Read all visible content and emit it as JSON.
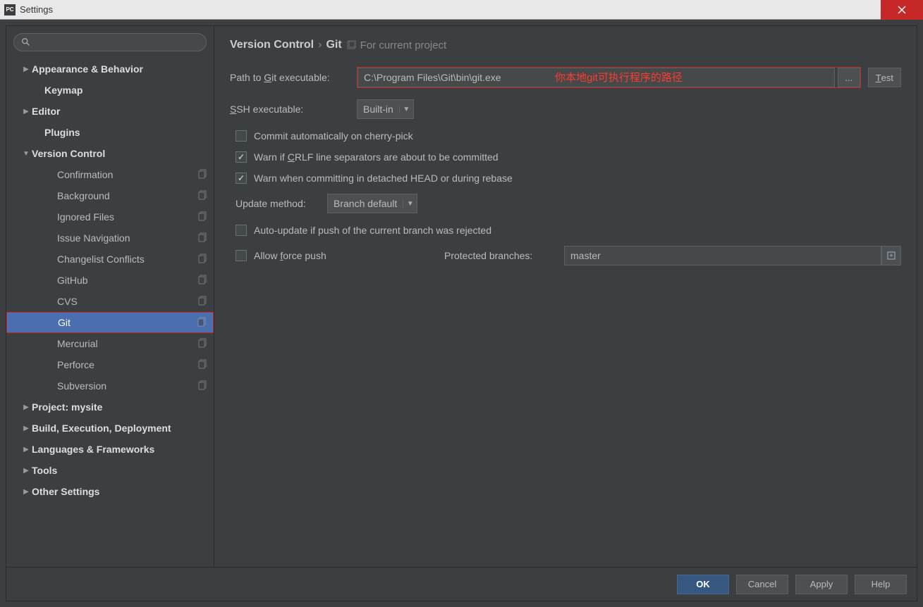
{
  "window": {
    "title": "Settings"
  },
  "sidebar": {
    "items": [
      {
        "label": "Appearance & Behavior",
        "arrow": "collapsed",
        "indent": 0,
        "bold": true
      },
      {
        "label": "Keymap",
        "arrow": "",
        "indent": 1,
        "bold": true
      },
      {
        "label": "Editor",
        "arrow": "collapsed",
        "indent": 0,
        "bold": true
      },
      {
        "label": "Plugins",
        "arrow": "",
        "indent": 1,
        "bold": true
      },
      {
        "label": "Version Control",
        "arrow": "expanded",
        "indent": 0,
        "bold": true
      },
      {
        "label": "Confirmation",
        "arrow": "",
        "indent": 2,
        "copy": true
      },
      {
        "label": "Background",
        "arrow": "",
        "indent": 2,
        "copy": true
      },
      {
        "label": "Ignored Files",
        "arrow": "",
        "indent": 2,
        "copy": true
      },
      {
        "label": "Issue Navigation",
        "arrow": "",
        "indent": 2,
        "copy": true
      },
      {
        "label": "Changelist Conflicts",
        "arrow": "",
        "indent": 2,
        "copy": true
      },
      {
        "label": "GitHub",
        "arrow": "",
        "indent": 2,
        "copy": true
      },
      {
        "label": "CVS",
        "arrow": "",
        "indent": 2,
        "copy": true
      },
      {
        "label": "Git",
        "arrow": "",
        "indent": 2,
        "copy": true,
        "selected": true
      },
      {
        "label": "Mercurial",
        "arrow": "",
        "indent": 2,
        "copy": true
      },
      {
        "label": "Perforce",
        "arrow": "",
        "indent": 2,
        "copy": true
      },
      {
        "label": "Subversion",
        "arrow": "",
        "indent": 2,
        "copy": true
      },
      {
        "label": "Project: mysite",
        "arrow": "collapsed",
        "indent": 0,
        "bold": true
      },
      {
        "label": "Build, Execution, Deployment",
        "arrow": "collapsed",
        "indent": 0,
        "bold": true
      },
      {
        "label": "Languages & Frameworks",
        "arrow": "collapsed",
        "indent": 0,
        "bold": true
      },
      {
        "label": "Tools",
        "arrow": "collapsed",
        "indent": 0,
        "bold": true
      },
      {
        "label": "Other Settings",
        "arrow": "collapsed",
        "indent": 0,
        "bold": true
      }
    ]
  },
  "breadcrumb": {
    "root": "Version Control",
    "leaf": "Git",
    "scope": "For current project"
  },
  "form": {
    "path_label_pre": "Path to ",
    "path_label_u": "G",
    "path_label_post": "it executable:",
    "path_value": "C:\\Program Files\\Git\\bin\\git.exe",
    "overlay": "你本地git可执行程序的路径",
    "browse": "...",
    "test": "T",
    "test_post": "est",
    "ssh_label_u": "S",
    "ssh_label_post": "SH executable:",
    "ssh_value": "Built-in",
    "chk_cherry": "Commit automatically on cherry-pick",
    "chk_crlf_pre": "Warn if ",
    "chk_crlf_u": "C",
    "chk_crlf_post": "RLF line separators are about to be committed",
    "chk_detached": "Warn when committing in detached HEAD or during rebase",
    "update_label": "Update method:",
    "update_value": "Branch default",
    "chk_autoupdate": "Auto-update if push of the current branch was rejected",
    "chk_force_pre": "Allow ",
    "chk_force_u": "f",
    "chk_force_post": "orce push",
    "protected_label": "Protected branches:",
    "protected_value": "master"
  },
  "footer": {
    "ok": "OK",
    "cancel": "Cancel",
    "apply": "Apply",
    "help": "Help"
  }
}
